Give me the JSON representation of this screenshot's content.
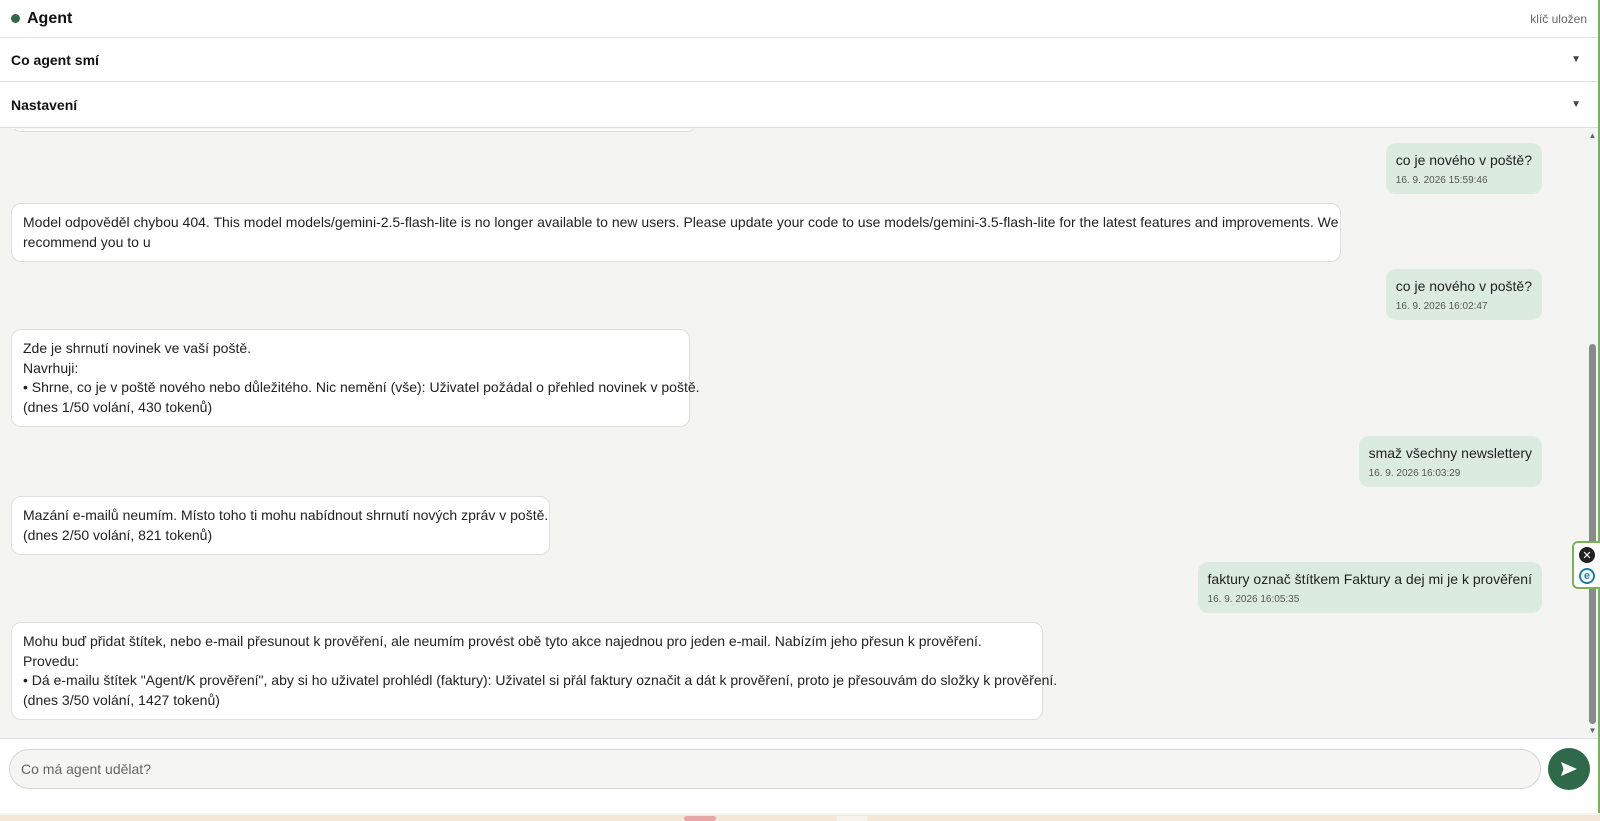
{
  "header": {
    "title": "Agent",
    "key_status": "klíč uložen",
    "sections": [
      {
        "label": "Co agent smí"
      },
      {
        "label": "Nastavení"
      }
    ]
  },
  "messages": [
    {
      "role": "user",
      "text": "co je nového v poště?",
      "timestamp": "16. 9. 2026 15:59:46"
    },
    {
      "role": "agent",
      "lines": [
        "Model odpověděl chybou 404. This model models/gemini-2.5-flash-lite is no longer available to new users. Please update your code to use models/gemini-3.5-flash-lite for the latest features and improvements. We",
        "recommend you to u"
      ]
    },
    {
      "role": "user",
      "text": "co je nového v poště?",
      "timestamp": "16. 9. 2026 16:02:47"
    },
    {
      "role": "agent",
      "lines": [
        "Zde je shrnutí novinek ve vaší poště.",
        "Navrhuji:",
        "• Shrne, co je v poště nového nebo důležitého. Nic nemění (vše): Uživatel požádal o přehled novinek v poště.",
        "(dnes 1/50 volání, 430 tokenů)"
      ]
    },
    {
      "role": "user",
      "text": "smaž všechny newslettery",
      "timestamp": "16. 9. 2026 16:03:29"
    },
    {
      "role": "agent",
      "lines": [
        "Mazání e-mailů neumím. Místo toho ti mohu nabídnout shrnutí nových zpráv v poště.",
        "(dnes 2/50 volání, 821 tokenů)"
      ]
    },
    {
      "role": "user",
      "text": "faktury označ štítkem Faktury a dej mi je k prověření",
      "timestamp": "16. 9. 2026 16:05:35"
    },
    {
      "role": "agent",
      "lines": [
        "Mohu buď přidat štítek, nebo e-mail přesunout k prověření, ale neumím provést obě tyto akce najednou pro jeden e-mail. Nabízím jeho přesun k prověření.",
        "Provedu:",
        "• Dá e-mailu štítek \"Agent/K prověření\", aby si ho uživatel prohlédl (faktury): Uživatel si přál faktury označit a dát k prověření, proto je přesouvám do složky k prověření.",
        "(dnes 3/50 volání, 1427 tokenů)"
      ]
    }
  ],
  "composer": {
    "placeholder": "Co má agent udělat?",
    "value": ""
  },
  "icons": {
    "send": "send-icon",
    "close": "close-icon",
    "extension": "extension-icon",
    "chevron": "chevron-down-icon"
  },
  "colors": {
    "accent": "#2e6a4a",
    "user_bubble": "#dcebdf",
    "agent_bubble": "#ffffff",
    "frame": "#7ab356"
  }
}
